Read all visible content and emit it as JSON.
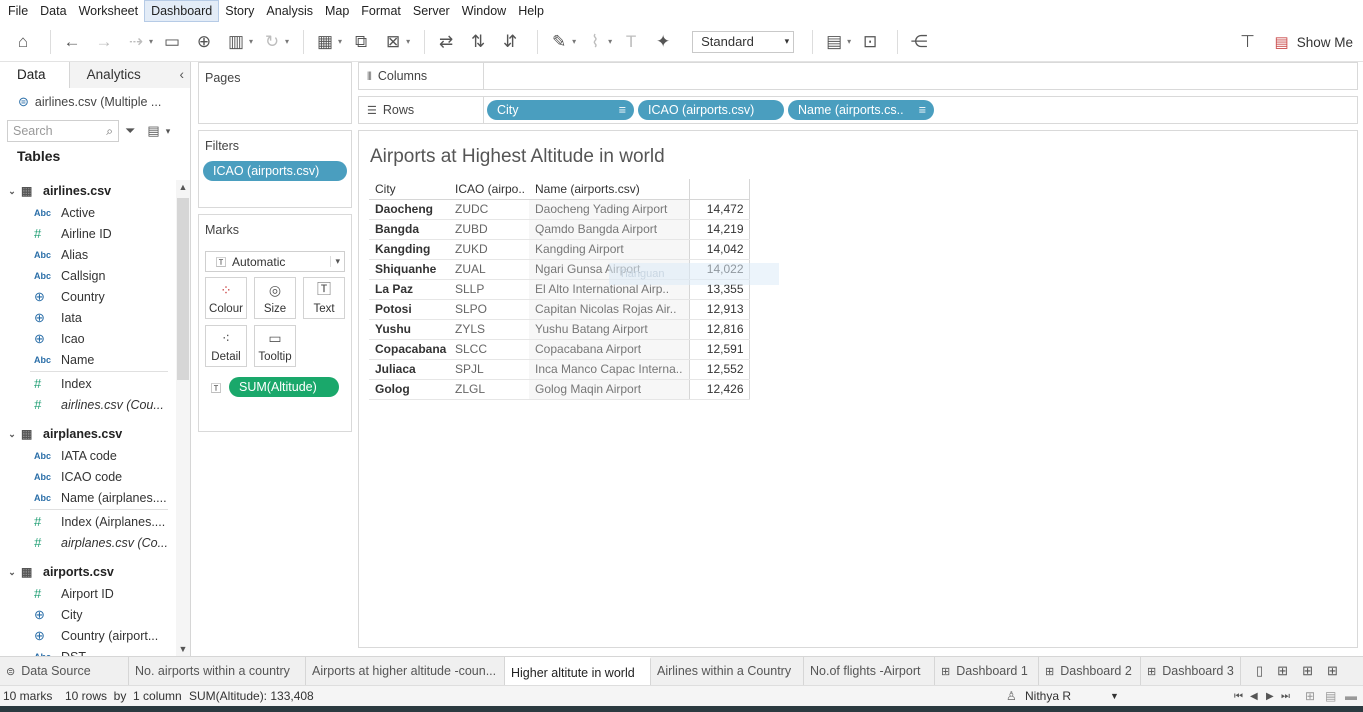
{
  "menu": [
    "File",
    "Data",
    "Worksheet",
    "Dashboard",
    "Story",
    "Analysis",
    "Map",
    "Format",
    "Server",
    "Window",
    "Help"
  ],
  "menu_active": "Dashboard",
  "toolbar": {
    "fit": "Standard",
    "show_me": "Show Me"
  },
  "left": {
    "tab_data": "Data",
    "tab_analytics": "Analytics",
    "datasource": "airlines.csv (Multiple ...",
    "search_placeholder": "Search",
    "tables_title": "Tables",
    "groups": [
      {
        "name": "airlines.csv",
        "fields": [
          {
            "t": "Abc",
            "n": "Active"
          },
          {
            "t": "#",
            "n": "Airline ID"
          },
          {
            "t": "Abc",
            "n": "Alias"
          },
          {
            "t": "Abc",
            "n": "Callsign"
          },
          {
            "t": "geo",
            "n": "Country"
          },
          {
            "t": "geo",
            "n": "Iata"
          },
          {
            "t": "geo",
            "n": "Icao"
          },
          {
            "t": "Abc",
            "n": "Name"
          },
          {
            "t": "#",
            "n": "Index",
            "sep": true
          },
          {
            "t": "#",
            "n": "airlines.csv (Cou...",
            "it": true
          }
        ]
      },
      {
        "name": "airplanes.csv",
        "fields": [
          {
            "t": "Abc",
            "n": "IATA code"
          },
          {
            "t": "Abc",
            "n": "ICAO code"
          },
          {
            "t": "Abc",
            "n": "Name (airplanes...."
          },
          {
            "t": "#",
            "n": "Index (Airplanes....",
            "sep": true
          },
          {
            "t": "#",
            "n": "airplanes.csv (Co...",
            "it": true
          }
        ]
      },
      {
        "name": "airports.csv",
        "fields": [
          {
            "t": "#",
            "n": "Airport ID"
          },
          {
            "t": "geo",
            "n": "City"
          },
          {
            "t": "geo",
            "n": "Country (airport..."
          },
          {
            "t": "Abc",
            "n": "DST"
          }
        ]
      }
    ]
  },
  "pages": {
    "title": "Pages"
  },
  "filters": {
    "title": "Filters",
    "pill": "ICAO (airports.csv)"
  },
  "marks": {
    "title": "Marks",
    "type": "Automatic",
    "buttons": [
      "Colour",
      "Size",
      "Text",
      "Detail",
      "Tooltip"
    ],
    "pill": "SUM(Altitude)"
  },
  "columns": {
    "label": "Columns"
  },
  "rows": {
    "label": "Rows",
    "pills": [
      "City",
      "ICAO (airports.csv)",
      "Name (airports.cs.."
    ]
  },
  "view": {
    "title": "Airports at Highest Altitude in world",
    "headers": [
      "City",
      "ICAO (airpo..",
      "Name (airports.csv)"
    ],
    "tooltip_ghost": "Tianguan",
    "rows": [
      {
        "city": "Daocheng",
        "icao": "ZUDC",
        "name": "Daocheng Yading Airport",
        "value": "14,472"
      },
      {
        "city": "Bangda",
        "icao": "ZUBD",
        "name": "Qamdo Bangda Airport",
        "value": "14,219"
      },
      {
        "city": "Kangding",
        "icao": "ZUKD",
        "name": "Kangding Airport",
        "value": "14,042"
      },
      {
        "city": "Shiquanhe",
        "icao": "ZUAL",
        "name": "Ngari Gunsa Airport",
        "value": "14,022"
      },
      {
        "city": "La Paz",
        "icao": "SLLP",
        "name": "El Alto International Airp..",
        "value": "13,355"
      },
      {
        "city": "Potosi",
        "icao": "SLPO",
        "name": "Capitan Nicolas Rojas Air..",
        "value": "12,913"
      },
      {
        "city": "Yushu",
        "icao": "ZYLS",
        "name": "Yushu Batang Airport",
        "value": "12,816"
      },
      {
        "city": "Copacabana",
        "icao": "SLCC",
        "name": "Copacabana Airport",
        "value": "12,591"
      },
      {
        "city": "Juliaca",
        "icao": "SPJL",
        "name": "Inca Manco Capac Interna..",
        "value": "12,552"
      },
      {
        "city": "Golog",
        "icao": "ZLGL",
        "name": "Golog Maqin Airport",
        "value": "12,426"
      }
    ]
  },
  "tabs": [
    {
      "label": "Data Source",
      "icon": "db"
    },
    {
      "label": "No. airports within a country"
    },
    {
      "label": "Airports at higher altitude -coun..."
    },
    {
      "label": "Higher altitute in world",
      "active": true
    },
    {
      "label": "Airlines within a Country"
    },
    {
      "label": "No.of flights -Airport"
    },
    {
      "label": "Dashboard 1",
      "icon": "dash"
    },
    {
      "label": "Dashboard 2",
      "icon": "dash"
    },
    {
      "label": "Dashboard 3",
      "icon": "dash"
    }
  ],
  "status": {
    "marks": "10 marks",
    "rows": "10 rows  by  1 column",
    "sum": "SUM(Altitude): 133,408",
    "user": "Nithya R"
  }
}
